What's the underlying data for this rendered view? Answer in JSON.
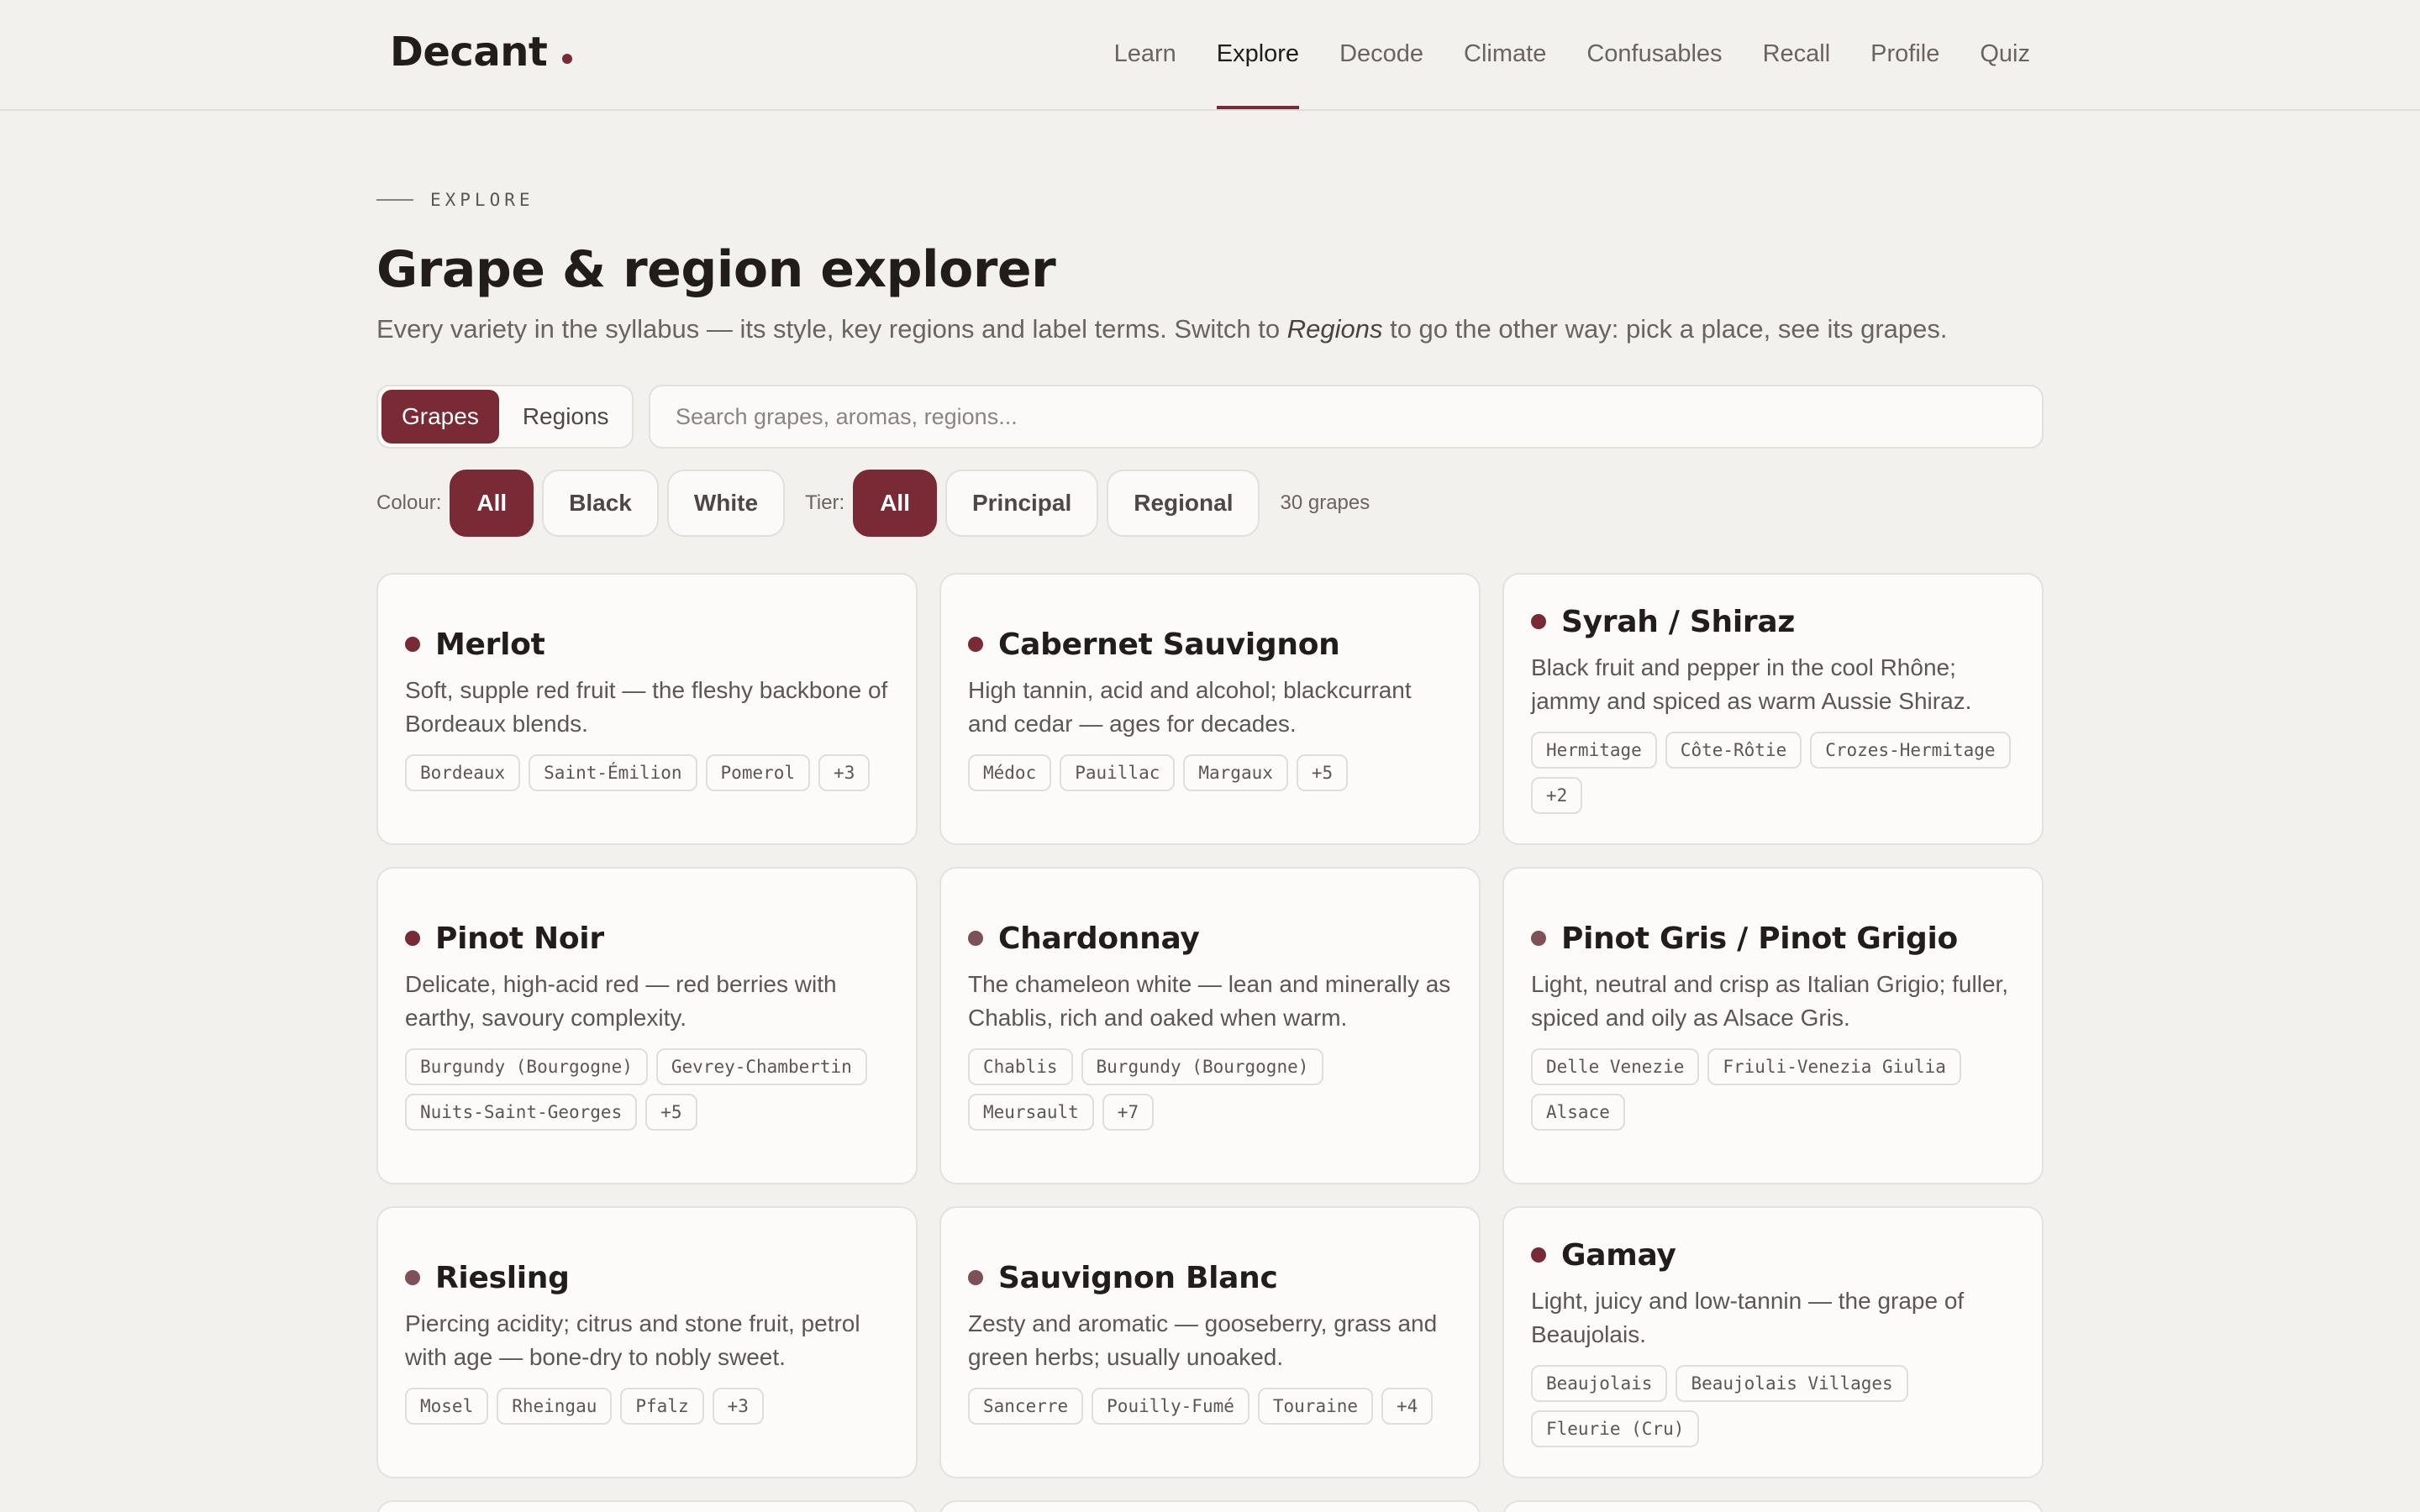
{
  "app": {
    "name": "Decant"
  },
  "nav": {
    "items": [
      "Learn",
      "Explore",
      "Decode",
      "Climate",
      "Confusables",
      "Recall",
      "Profile",
      "Quiz"
    ],
    "active": "Explore"
  },
  "hero": {
    "eyebrow": "EXPLORE",
    "title": "Grape & region explorer",
    "sub_before": "Every variety in the syllabus — its style, key regions and label terms. Switch to ",
    "sub_em": "Regions",
    "sub_after": " to go the other way: pick a place, see its grapes."
  },
  "view_toggle": {
    "grapes": "Grapes",
    "regions": "Regions",
    "active": "Grapes"
  },
  "search": {
    "placeholder": "Search grapes, aromas, regions...",
    "value": ""
  },
  "filters": {
    "colour_label": "Colour:",
    "colour_options": [
      "All",
      "Black",
      "White"
    ],
    "colour_active": "All",
    "tier_label": "Tier:",
    "tier_options": [
      "All",
      "Principal",
      "Regional"
    ],
    "tier_active": "All",
    "count": "30 grapes"
  },
  "colors": {
    "accent": "#7a2a35",
    "background": "#f3f1ee",
    "card": "#fcfbf9"
  },
  "cards": [
    {
      "name": "Merlot",
      "colour": "black",
      "desc": "Soft, supple red fruit — the fleshy backbone of Bordeaux blends.",
      "tags": [
        "Bordeaux",
        "Saint-Émilion",
        "Pomerol",
        "+3"
      ]
    },
    {
      "name": "Cabernet Sauvignon",
      "colour": "black",
      "desc": "High tannin, acid and alcohol; blackcurrant and cedar — ages for decades.",
      "tags": [
        "Médoc",
        "Pauillac",
        "Margaux",
        "+5"
      ]
    },
    {
      "name": "Syrah / Shiraz",
      "colour": "black",
      "desc": "Black fruit and pepper in the cool Rhône; jammy and spiced as warm Aussie Shiraz.",
      "tags": [
        "Hermitage",
        "Côte-Rôtie",
        "Crozes-Hermitage",
        "+2"
      ]
    },
    {
      "name": "Pinot Noir",
      "colour": "black",
      "desc": "Delicate, high-acid red — red berries with earthy, savoury complexity.",
      "tags": [
        "Burgundy (Bourgogne)",
        "Gevrey-Chambertin",
        "Nuits-Saint-Georges",
        "+5"
      ]
    },
    {
      "name": "Chardonnay",
      "colour": "white",
      "desc": "The chameleon white — lean and minerally as Chablis, rich and oaked when warm.",
      "tags": [
        "Chablis",
        "Burgundy (Bourgogne)",
        "Meursault",
        "+7"
      ]
    },
    {
      "name": "Pinot Gris / Pinot Grigio",
      "colour": "white",
      "desc": "Light, neutral and crisp as Italian Grigio; fuller, spiced and oily as Alsace Gris.",
      "tags": [
        "Delle Venezie",
        "Friuli-Venezia Giulia",
        "Alsace"
      ]
    },
    {
      "name": "Riesling",
      "colour": "white",
      "desc": "Piercing acidity; citrus and stone fruit, petrol with age — bone-dry to nobly sweet.",
      "tags": [
        "Mosel",
        "Rheingau",
        "Pfalz",
        "+3"
      ]
    },
    {
      "name": "Sauvignon Blanc",
      "colour": "white",
      "desc": "Zesty and aromatic — gooseberry, grass and green herbs; usually unoaked.",
      "tags": [
        "Sancerre",
        "Pouilly-Fumé",
        "Touraine",
        "+4"
      ]
    },
    {
      "name": "Gamay",
      "colour": "black",
      "desc": "Light, juicy and low-tannin — the grape of Beaujolais.",
      "tags": [
        "Beaujolais",
        "Beaujolais Villages",
        "Fleurie (Cru)"
      ]
    }
  ]
}
